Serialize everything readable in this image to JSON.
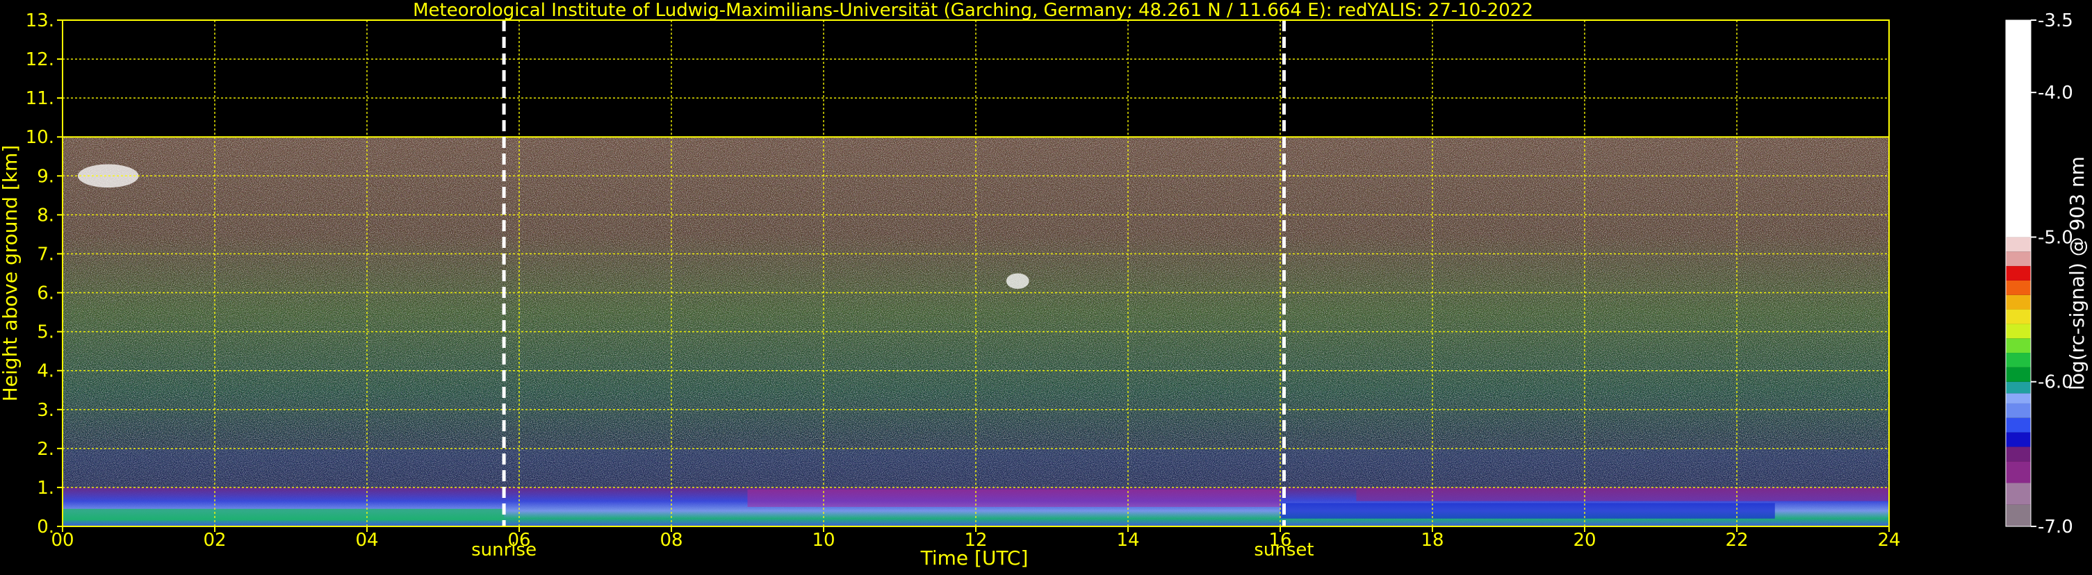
{
  "chart_data": {
    "type": "heatmap",
    "title": "Meteorological Institute of Ludwig-Maximilians-Universität (Garching, Germany; 48.261 N / 11.664 E):    redYALIS: 27-10-2022",
    "xlabel": "Time [UTC]",
    "ylabel": "Height above ground [km]",
    "xlim": [
      0,
      24
    ],
    "ylim": [
      0,
      13
    ],
    "x_ticks": [
      "00",
      "02",
      "04",
      "06",
      "08",
      "10",
      "12",
      "14",
      "16",
      "18",
      "20",
      "22",
      "24"
    ],
    "y_ticks": [
      "0.",
      "1.",
      "2.",
      "3.",
      "4.",
      "5.",
      "6.",
      "7.",
      "8.",
      "9.",
      "10.",
      "11.",
      "12.",
      "13."
    ],
    "grid": true,
    "data_top_km": 10,
    "annotations": [
      {
        "label": "sunrise",
        "x": 5.8
      },
      {
        "label": "sunset",
        "x": 16.05
      }
    ],
    "colorbar": {
      "label": "log(rc-signal) @ 903 nm",
      "range": [
        -7.0,
        -3.5
      ],
      "ticks": [
        {
          "value": -3.5,
          "label": "-3.5"
        },
        {
          "value": -4.0,
          "label": "-4.0"
        },
        {
          "value": -5.0,
          "label": "-5.0"
        },
        {
          "value": -6.0,
          "label": "-6.0"
        },
        {
          "value": -7.0,
          "label": "-7.0"
        }
      ],
      "bands": [
        {
          "from": -7.0,
          "to": -6.85,
          "color": "#8a7a88"
        },
        {
          "from": -6.85,
          "to": -6.7,
          "color": "#a07aa0"
        },
        {
          "from": -6.7,
          "to": -6.55,
          "color": "#8a2a8a"
        },
        {
          "from": -6.55,
          "to": -6.45,
          "color": "#70207a"
        },
        {
          "from": -6.45,
          "to": -6.35,
          "color": "#1010c8"
        },
        {
          "from": -6.35,
          "to": -6.25,
          "color": "#3050f0"
        },
        {
          "from": -6.25,
          "to": -6.15,
          "color": "#6a8af0"
        },
        {
          "from": -6.15,
          "to": -6.08,
          "color": "#8aa8f8"
        },
        {
          "from": -6.08,
          "to": -6.0,
          "color": "#20a0a0"
        },
        {
          "from": -6.0,
          "to": -5.9,
          "color": "#009a30"
        },
        {
          "from": -5.9,
          "to": -5.8,
          "color": "#20c040"
        },
        {
          "from": -5.8,
          "to": -5.7,
          "color": "#70e030"
        },
        {
          "from": -5.7,
          "to": -5.6,
          "color": "#d0f020"
        },
        {
          "from": -5.6,
          "to": -5.5,
          "color": "#f0e020"
        },
        {
          "from": -5.5,
          "to": -5.4,
          "color": "#f0b010"
        },
        {
          "from": -5.4,
          "to": -5.3,
          "color": "#f06010"
        },
        {
          "from": -5.3,
          "to": -5.2,
          "color": "#e01010"
        },
        {
          "from": -5.2,
          "to": -5.1,
          "color": "#e0a0a0"
        },
        {
          "from": -5.1,
          "to": -5.0,
          "color": "#f0d0d0"
        },
        {
          "from": -5.0,
          "to": -3.5,
          "color": "#ffffff"
        }
      ]
    },
    "layers": [
      {
        "name": "boundary-layer",
        "description": "aerosol layer below ~1 km, blue/green/purple"
      },
      {
        "name": "cirrus",
        "time": [
          0.2,
          1.0
        ],
        "height": [
          8.7,
          9.3
        ],
        "color": "white"
      },
      {
        "name": "cloud",
        "time": [
          12.4,
          12.7
        ],
        "height": [
          6.1,
          6.5
        ],
        "color": "white"
      }
    ]
  }
}
